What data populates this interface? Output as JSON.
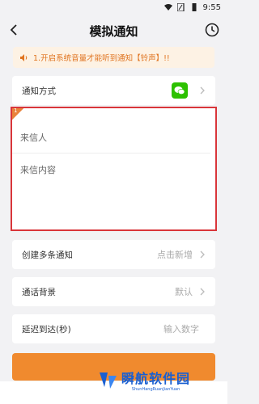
{
  "status": {
    "time": "9:55"
  },
  "header": {
    "title": "模拟通知"
  },
  "notice": {
    "text": "1.开启系统音量才能听到通知【铃声】!!"
  },
  "notify_method": {
    "label": "通知方式"
  },
  "input_block": {
    "index": "1",
    "sender_placeholder": "来信人",
    "content_placeholder": "来信内容"
  },
  "multi": {
    "label": "创建多条通知",
    "value": "点击新增"
  },
  "background": {
    "label": "通话背景",
    "value": "默认"
  },
  "delay": {
    "label": "延迟到达(秒)",
    "placeholder": "输入数字"
  },
  "watermark": {
    "title": "瞬航软件园",
    "subtitle": "ShunHangRuanJianYuan"
  },
  "colors": {
    "accent": "#f08a2e",
    "highlight_border": "#d9353a",
    "wechat": "#2dc100"
  }
}
